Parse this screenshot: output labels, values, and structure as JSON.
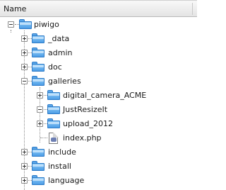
{
  "header": {
    "name_column": "Name"
  },
  "tree": {
    "root": {
      "label": "piwigo",
      "expanded": true,
      "icon": "folder-icon"
    },
    "children": [
      {
        "label": "_data",
        "expanded": false,
        "icon": "folder-icon"
      },
      {
        "label": "admin",
        "expanded": false,
        "icon": "folder-icon"
      },
      {
        "label": "doc",
        "expanded": false,
        "icon": "folder-icon"
      },
      {
        "label": "galleries",
        "expanded": true,
        "icon": "folder-icon",
        "children": [
          {
            "label": "digital_camera_ACME",
            "expanded": false,
            "icon": "folder-icon"
          },
          {
            "label": "JustResizeIt",
            "expanded": true,
            "icon": "folder-icon"
          },
          {
            "label": "upload_2012",
            "expanded": false,
            "icon": "folder-icon"
          },
          {
            "label": "index.php",
            "icon": "php-file-icon"
          }
        ]
      },
      {
        "label": "include",
        "expanded": false,
        "icon": "folder-icon"
      },
      {
        "label": "install",
        "expanded": false,
        "icon": "folder-icon"
      },
      {
        "label": "language",
        "expanded": false,
        "icon": "folder-icon"
      }
    ]
  }
}
